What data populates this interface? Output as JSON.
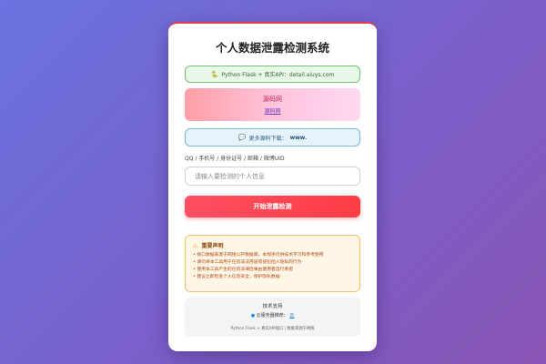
{
  "app": {
    "title": "个人数据泄露检测系统"
  },
  "tech_badge": {
    "icon": "snake-icon",
    "text": "Python Flask + 真实API：detail.aiuys.com"
  },
  "source_banner": {
    "line1": "源码网",
    "line2": "源码网"
  },
  "more_banner": {
    "icon": "chat-icon",
    "text": "更多源码下载：",
    "link": "www."
  },
  "search": {
    "label": "QQ / 手机号 / 身份证号 / 邮箱 / 微博UID",
    "placeholder": "请输入要检测的个人信息"
  },
  "submit": {
    "label": "开始泄露检测"
  },
  "disclaimer": {
    "icon": "warning-icon",
    "title": "重要声明",
    "items": [
      "• 接口数据来源于网络公开数据库，本程序仅供技术学习和参考使用",
      "• 请勿将本工具用于任何非法用途或侵犯他人隐私的行为",
      "• 使用本工具产生的任何法律后果由使用者自行承担",
      "• 建议立即检查个人信息安全，保护隐私数据"
    ]
  },
  "footer": {
    "support_title": "技术支持",
    "sponsor_label": "云服务器推荐：",
    "sponsor_link": "云",
    "credit": "Python Flask + 真实API接口 | 数据来源于网络"
  },
  "colors": {
    "accent": "#ff3d45",
    "success_border": "#6fc26f",
    "info_border": "#74b6dd",
    "warning_border": "#f2c16a"
  }
}
